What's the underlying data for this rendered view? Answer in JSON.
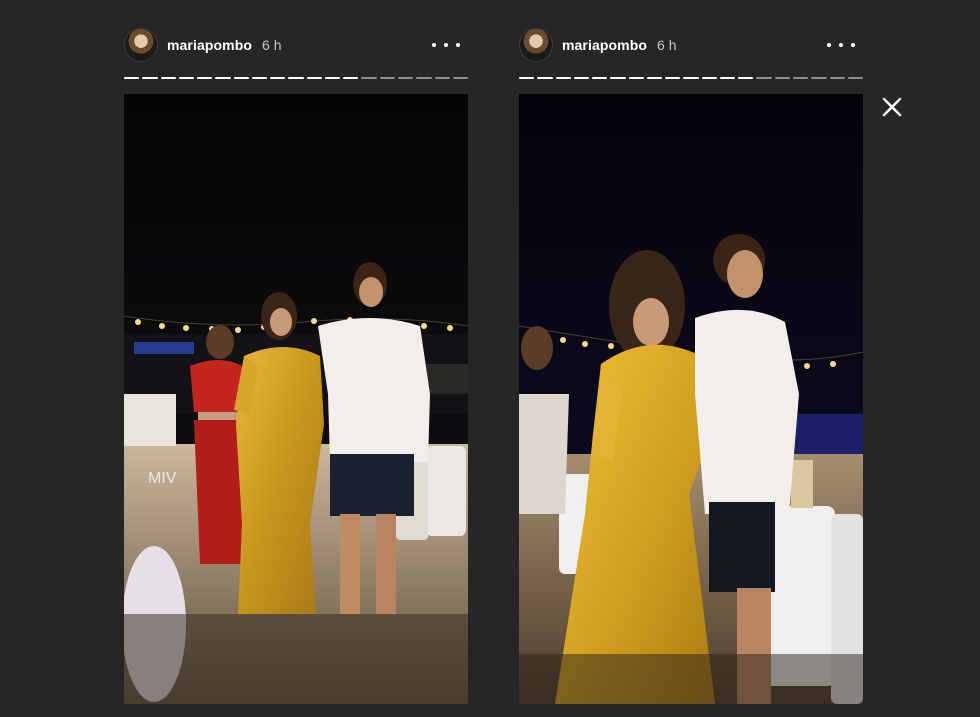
{
  "stories": [
    {
      "username": "mariapombo",
      "time": "6 h",
      "progress_total": 19,
      "progress_filled": 13,
      "media_text": "MIV"
    },
    {
      "username": "mariapombo",
      "time": "6 h",
      "progress_total": 19,
      "progress_filled": 13
    }
  ],
  "icons": {
    "more": "more-options-icon",
    "close": "close-icon",
    "avatar": "profile-avatar"
  }
}
